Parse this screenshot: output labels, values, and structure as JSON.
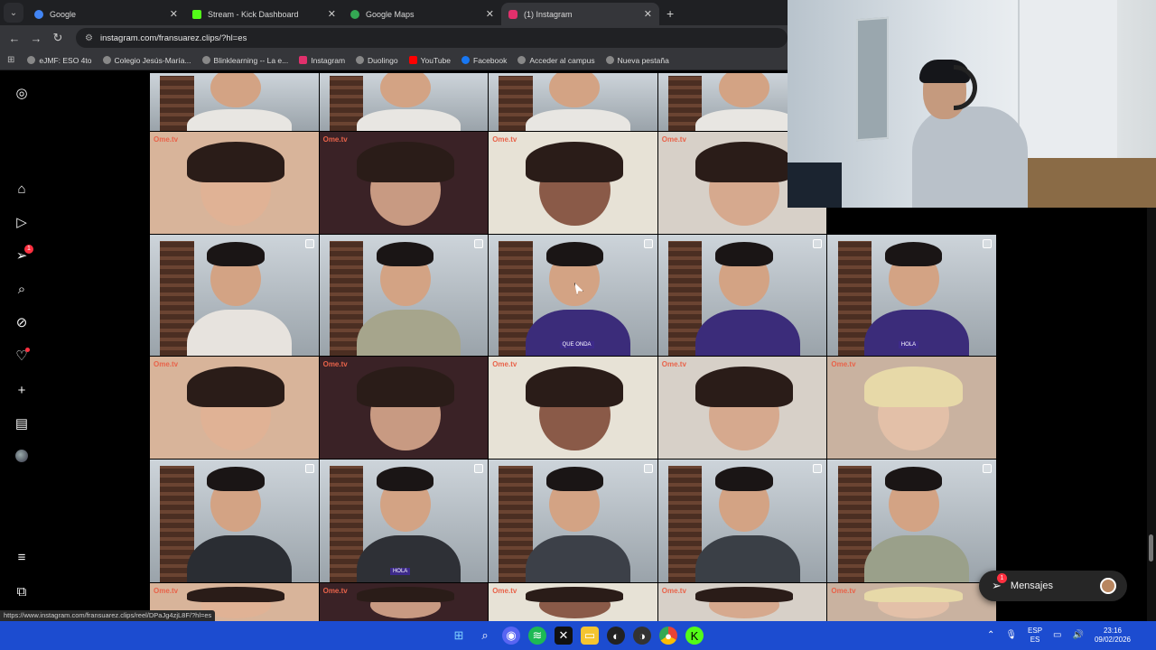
{
  "browser": {
    "tabs": [
      {
        "title": "Google",
        "favicon_color": "#4285f4",
        "active": false
      },
      {
        "title": "Stream - Kick Dashboard",
        "favicon_color": "#53fc18",
        "active": false
      },
      {
        "title": "Google Maps",
        "favicon_color": "#34a853",
        "active": false
      },
      {
        "title": "(1) Instagram",
        "favicon_color": "#e1306c",
        "active": true
      }
    ],
    "url": "instagram.com/fransuarez.clips/?hl=es",
    "bookmarks": [
      {
        "label": "eJMF: ESO 4to",
        "color": "#888"
      },
      {
        "label": "Colegio Jesús-María...",
        "color": "#888"
      },
      {
        "label": "Blinklearning -- La e...",
        "color": "#888"
      },
      {
        "label": "Instagram",
        "color": "#e1306c"
      },
      {
        "label": "Duolingo",
        "color": "#888"
      },
      {
        "label": "YouTube",
        "color": "#ff0000"
      },
      {
        "label": "Facebook",
        "color": "#1877f2"
      },
      {
        "label": "Acceder al campus",
        "color": "#888"
      },
      {
        "label": "Nueva pestaña",
        "color": "#888"
      }
    ],
    "status_url": "https://www.instagram.com/fransuarez.clips/reel/DPaJg4zjL8F/?hl=es"
  },
  "instagram": {
    "sidebar_icons": [
      "instagram-logo-icon",
      "home-icon",
      "reels-icon",
      "messages-icon",
      "search-icon",
      "explore-icon",
      "notifications-icon",
      "create-icon",
      "dashboard-icon",
      "profile-avatar",
      "menu-icon",
      "meta-icon"
    ],
    "messages_badge": "1",
    "grid_rows": 5,
    "ome_label": "Ome.tv",
    "shirt_labels": [
      "QUE ONDA",
      "HOLA",
      "HOLA"
    ],
    "messages_button": {
      "label": "Mensajes",
      "badge": "1"
    }
  },
  "taskbar": {
    "lang_top": "ESP",
    "lang_bottom": "ES",
    "time": "23:16",
    "date": "09/02/2026"
  }
}
